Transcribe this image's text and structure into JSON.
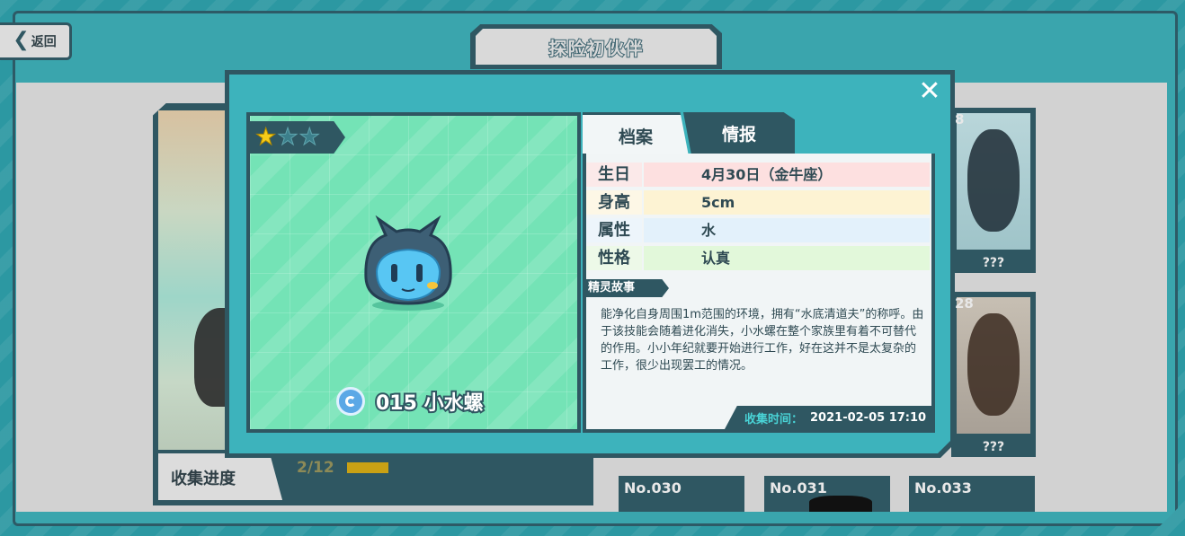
{
  "header": {
    "back_label": "返回",
    "title": "探险初伙伴"
  },
  "background": {
    "progress_label": "收集进度",
    "progress_count": "2/12",
    "progress_fraction": 0.17,
    "cards": [
      {
        "caption": "???",
        "number_partial": "8"
      },
      {
        "caption": "???",
        "number_partial": "28"
      }
    ],
    "bottom_cards": [
      "No.030",
      "No.031",
      "No.033"
    ]
  },
  "modal": {
    "rarity": {
      "filled": 1,
      "total": 3
    },
    "creature_name": "015 小水螺",
    "element_icon": "water-element-icon",
    "tabs": [
      {
        "label": "档案",
        "active": true
      },
      {
        "label": "情报",
        "active": false
      }
    ],
    "profile": [
      {
        "key": "生日",
        "value": "4月30日（金牛座）",
        "color": "#fde0e0"
      },
      {
        "key": "身高",
        "value": "5cm",
        "color": "#fdf3d3"
      },
      {
        "key": "属性",
        "value": "水",
        "color": "#e3f1fb"
      },
      {
        "key": "性格",
        "value": "认真",
        "color": "#e2f8da"
      }
    ],
    "story_label": "精灵故事",
    "story": "能净化自身周围1m范围的环境，拥有“水底清道夫”的称呼。由于该技能会随着进化消失，小水螺在整个家族里有着不可替代的作用。小小年纪就要开始进行工作，好在这并不是太复杂的工作，很少出现罢工的情况。",
    "collect_time_label": "收集时间：",
    "collect_time_value": "2021-02-05 17:10"
  },
  "colors": {
    "frame_dark": "#2f5762",
    "modal_teal": "#3db3bc",
    "portrait_mint": "#74e3b6",
    "star_gold": "#f5cc1a"
  }
}
